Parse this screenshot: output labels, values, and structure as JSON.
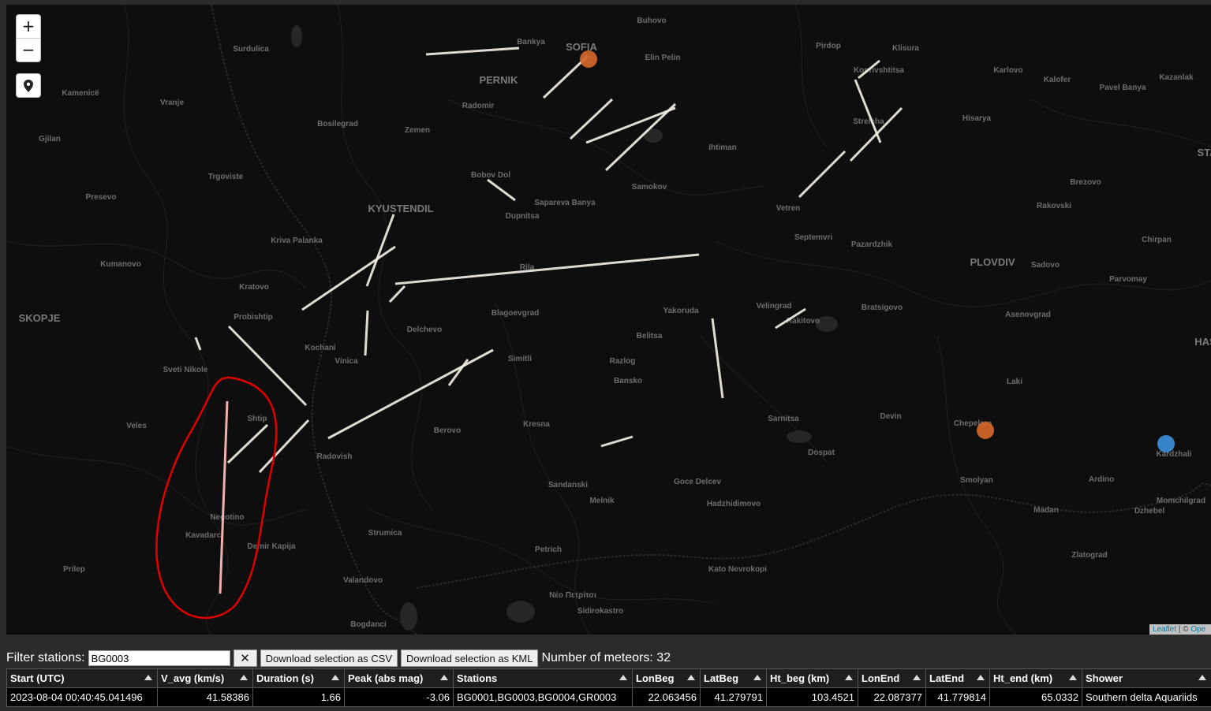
{
  "map": {
    "city_labels": [
      "SOFIA",
      "PERNIK",
      "KYUSTENDIL",
      "SKOPJE",
      "PLOVDIV",
      "Bankya",
      "Buhovo",
      "Elin Pelin",
      "Pirdop",
      "Klisura",
      "Koprivshtitsa",
      "Karlovo",
      "Kalofer",
      "Pavel Banya",
      "Kazanlak",
      "Surdulica",
      "Kamenicë",
      "Vranje",
      "Gjilan",
      "Bosilegrad",
      "Radomir",
      "Zemen",
      "Strelcha",
      "Hisarya",
      "Ihtiman",
      "Samokov",
      "Trgoviste",
      "Presevo",
      "Bobov Dol",
      "Sapareva Banya",
      "Dupnitsa",
      "Vetren",
      "Brezovo",
      "Rakovski",
      "Kriva Palanka",
      "Kumanovo",
      "Kratovo",
      "Rila",
      "Septemvri",
      "Pazardzhik",
      "Sadovo",
      "Chirpan",
      "Parvomay",
      "Probishtip",
      "Blagoevgrad",
      "Yakoruda",
      "Velingrad",
      "Rakitovo",
      "Bratsigovo",
      "Asenovgrad",
      "Delchevo",
      "Kochani",
      "Vinica",
      "Belitsa",
      "Razlog",
      "Bansko",
      "Simitli",
      "Sveti Nikole",
      "Shtip",
      "Kresna",
      "Berovo",
      "Radovish",
      "Sarnitsa",
      "Devin",
      "Dospat",
      "Laki",
      "Chepelare",
      "Veles",
      "Sandanski",
      "Melnik",
      "Goce Delcev",
      "Hadzhidimovo",
      "Smolyan",
      "Ardino",
      "Momchilgrad",
      "Kardzhali",
      "Madan",
      "Dzhebel",
      "Negotino",
      "Kavadarci",
      "Demir Kapija",
      "Strumica",
      "Petrich",
      "Zlatograd",
      "Kato Nevrokopi",
      "Prilep",
      "Valandovo",
      "Νέο Πετρίτσι",
      "Sidirokastro",
      "Bogdanci",
      "STA",
      "HAS"
    ]
  },
  "controls": {
    "zoom_in": "+",
    "zoom_out": "−",
    "locate_icon": "map-marker-icon"
  },
  "attribution": {
    "leaflet": "Leaflet",
    "separator": " | © ",
    "osm": "Ope"
  },
  "toolbar": {
    "filter_label": "Filter stations:",
    "filter_value": "BG0003",
    "clear_label": "✕",
    "csv_label": "Download selection as CSV",
    "kml_label": "Download selection as KML",
    "count_text": "Number of meteors: 32"
  },
  "table": {
    "headers": [
      "Start (UTC)",
      "V_avg (km/s)",
      "Duration (s)",
      "Peak (abs mag)",
      "Stations",
      "LonBeg",
      "LatBeg",
      "Ht_beg (km)",
      "LonEnd",
      "LatEnd",
      "Ht_end (km)",
      "Shower"
    ],
    "rows": [
      [
        "2023-08-04 00:40:45.041496",
        "41.58386",
        "1.66",
        "-3.06",
        "BG0001,BG0003,BG0004,GR0003",
        "22.063456",
        "41.279791",
        "103.4521",
        "22.087377",
        "41.779814",
        "65.0332",
        "Southern delta Aquariids"
      ]
    ]
  },
  "colors": {
    "map_bg": "#0e0e0e",
    "meteor_start": "#f6f2e6",
    "meteor_end": "#8f8a58",
    "station_orange": "#d2672a",
    "station_blue": "#3b8fd8",
    "highlight_circle": "#e00000",
    "highlight_meteor": "#f0b0b0"
  }
}
